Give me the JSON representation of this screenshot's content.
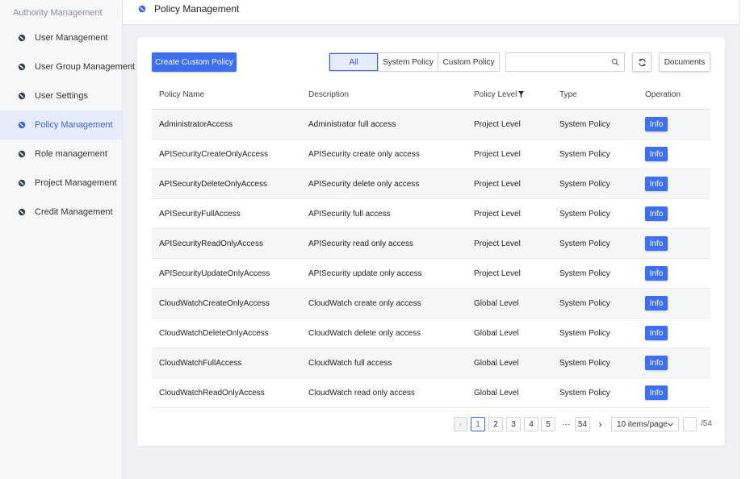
{
  "sidebar": {
    "title": "Authority Management",
    "items": [
      {
        "label": "User Management"
      },
      {
        "label": "User Group Management"
      },
      {
        "label": "User Settings"
      },
      {
        "label": "Policy Management"
      },
      {
        "label": "Role management"
      },
      {
        "label": "Project Management"
      },
      {
        "label": "Credit Management"
      }
    ]
  },
  "header": {
    "title": "Policy Management"
  },
  "toolbar": {
    "create_label": "Create Custom Policy",
    "filters": [
      "All",
      "System Policy",
      "Custom Policy"
    ],
    "search_value": "",
    "docs_label": "Documents"
  },
  "table": {
    "headers": {
      "name": "Policy Name",
      "description": "Description",
      "level": "Policy Level",
      "type": "Type",
      "operation": "Operation"
    },
    "info_label": "Info",
    "rows": [
      {
        "name": "AdministratorAccess",
        "description": "Administrator full access",
        "level": "Project Level",
        "type": "System Policy"
      },
      {
        "name": "APISecurityCreateOnlyAccess",
        "description": "APISecurity create only access",
        "level": "Project Level",
        "type": "System Policy"
      },
      {
        "name": "APISecurityDeleteOnlyAccess",
        "description": "APISecurity delete only access",
        "level": "Project Level",
        "type": "System Policy"
      },
      {
        "name": "APISecurityFullAccess",
        "description": "APISecurity full access",
        "level": "Project Level",
        "type": "System Policy"
      },
      {
        "name": "APISecurityReadOnlyAccess",
        "description": "APISecurity read only access",
        "level": "Project Level",
        "type": "System Policy"
      },
      {
        "name": "APISecurityUpdateOnlyAccess",
        "description": "APISecurity update only access",
        "level": "Project Level",
        "type": "System Policy"
      },
      {
        "name": "CloudWatchCreateOnlyAccess",
        "description": "CloudWatch create only access",
        "level": "Global Level",
        "type": "System Policy"
      },
      {
        "name": "CloudWatchDeleteOnlyAccess",
        "description": "CloudWatch delete only access",
        "level": "Global Level",
        "type": "System Policy"
      },
      {
        "name": "CloudWatchFullAccess",
        "description": "CloudWatch full access",
        "level": "Global Level",
        "type": "System Policy"
      },
      {
        "name": "CloudWatchReadOnlyAccess",
        "description": "CloudWatch read only access",
        "level": "Global Level",
        "type": "System Policy"
      }
    ]
  },
  "pagination": {
    "pages": [
      "1",
      "2",
      "3",
      "4",
      "5"
    ],
    "ellipsis": "···",
    "last_page": "54",
    "next": "›",
    "prev": "‹",
    "page_size": "10 items/page",
    "total": "/54"
  },
  "colors": {
    "accent": "#3d6ff0",
    "active_bg": "#e6ecfb"
  },
  "icons": {
    "nav": "nav-bullet-icon",
    "search": "search-icon",
    "refresh": "refresh-icon",
    "filter": "filter-icon",
    "chevron": "chevron-down-icon"
  }
}
